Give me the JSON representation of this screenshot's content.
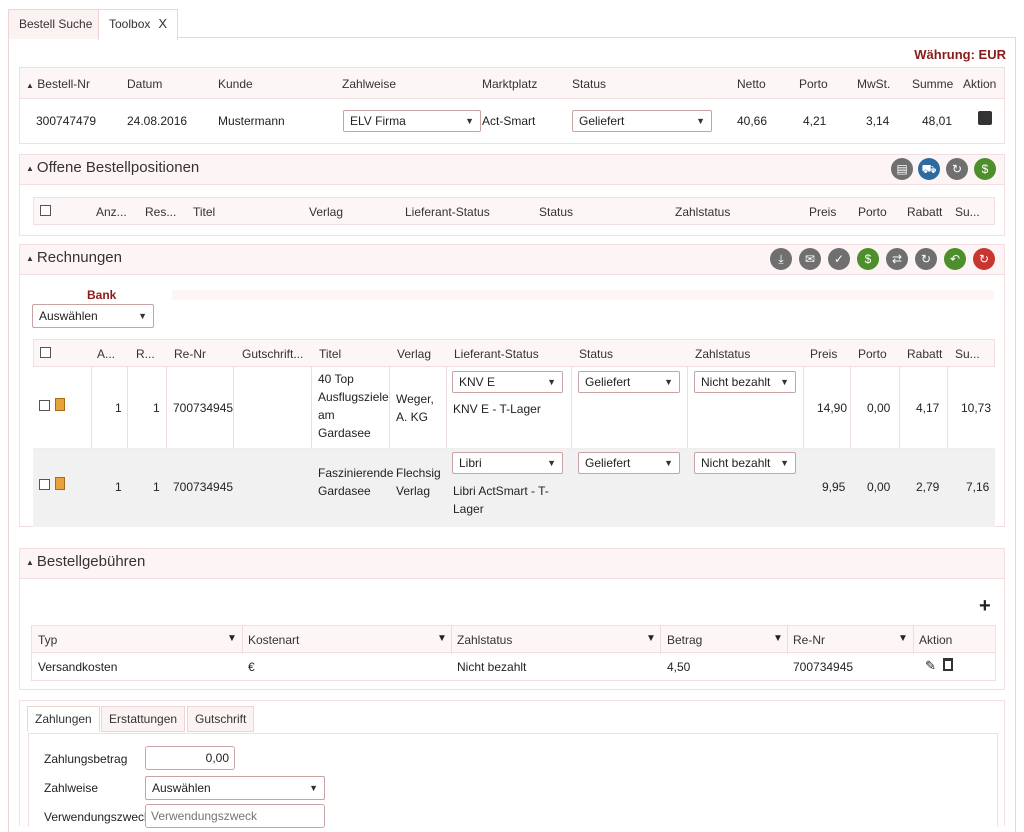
{
  "tabs": [
    {
      "label": "Bestell Suche"
    },
    {
      "label": "Toolbox",
      "close": "X"
    }
  ],
  "currency": {
    "label": "Währung:",
    "value": "EUR"
  },
  "order_table": {
    "columns": [
      "Bestell-Nr",
      "Datum",
      "Kunde",
      "Zahlweise",
      "Marktplatz",
      "Status",
      "Netto",
      "Porto",
      "MwSt.",
      "Summe",
      "Aktion"
    ],
    "row": {
      "bestell_nr": "300747479",
      "datum": "24.08.2016",
      "kunde": "Mustermann",
      "zahlweise": "ELV Firma",
      "marktplatz": "Act-Smart",
      "status": "Geliefert",
      "netto": "40,66",
      "porto": "4,21",
      "mwst": "3,14",
      "summe": "48,01"
    }
  },
  "open_positions": {
    "title": "Offene Bestellpositionen",
    "columns": [
      "Anz...",
      "Res...",
      "Titel",
      "Verlag",
      "Lieferant-Status",
      "Status",
      "Zahlstatus",
      "Preis",
      "Porto",
      "Rabatt",
      "Su..."
    ]
  },
  "invoices": {
    "title": "Rechnungen",
    "bank_label": "Bank",
    "bank_select": "Auswählen",
    "columns": [
      "A...",
      "R...",
      "Re-Nr",
      "Gutschrift...",
      "Titel",
      "Verlag",
      "Lieferant-Status",
      "Status",
      "Zahlstatus",
      "Preis",
      "Porto",
      "Rabatt",
      "Su..."
    ],
    "rows": [
      {
        "a": "1",
        "r": "1",
        "re_nr": "700734945",
        "titel": [
          "40 Top",
          "Ausflugsziele",
          "am",
          "Gardasee"
        ],
        "verlag": [
          "Weger,",
          "A. KG"
        ],
        "lieferant": "KNV E",
        "lieferant_sub": "KNV E - T-Lager",
        "status": "Geliefert",
        "zahlstatus": "Nicht bezahlt",
        "preis": "14,90",
        "porto": "0,00",
        "rabatt": "4,17",
        "summe": "10,73"
      },
      {
        "a": "1",
        "r": "1",
        "re_nr": "700734945",
        "titel": [
          "Faszinierende",
          "Gardasee"
        ],
        "verlag": [
          "Flechsig",
          "Verlag"
        ],
        "lieferant": "Libri",
        "lieferant_sub": [
          "Libri ActSmart - T-",
          "Lager"
        ],
        "status": "Geliefert",
        "zahlstatus": "Nicht bezahlt",
        "preis": "9,95",
        "porto": "0,00",
        "rabatt": "2,79",
        "summe": "7,16"
      }
    ]
  },
  "fees": {
    "title": "Bestellgebühren",
    "add": "+",
    "columns": [
      "Typ",
      "Kostenart",
      "Zahlstatus",
      "Betrag",
      "Re-Nr",
      "Aktion"
    ],
    "row": {
      "typ": "Versandkosten",
      "kostenart": "€",
      "zahlstatus": "Nicht bezahlt",
      "betrag": "4,50",
      "re_nr": "700734945"
    }
  },
  "payment_tabs": [
    "Zahlungen",
    "Erstattungen",
    "Gutschrift"
  ],
  "payment_form": {
    "amount_label": "Zahlungsbetrag",
    "amount_value": "0,00",
    "method_label": "Zahlweise",
    "method_value": "Auswählen",
    "purpose_label": "Verwendungszweck",
    "purpose_placeholder": "Verwendungszweck"
  }
}
